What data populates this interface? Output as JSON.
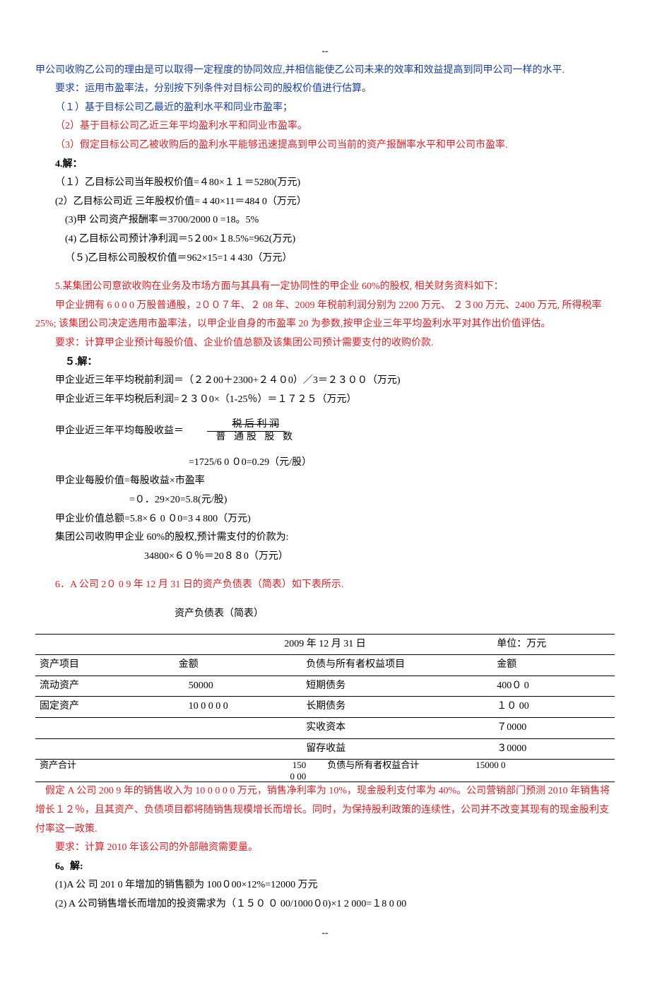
{
  "hdr": "--",
  "p1": "甲公司收购乙公司的理由是可以取得一定程度的协同效应,并相信能使乙公司未来的效率和效益提高到同甲公司一样的水平.",
  "p2": "要求：运用市盈率法，分别按下列条件对目标公司的股权价值进行估算。",
  "p3": "（１）基于目标公司乙最近的盈利水平和同业市盈率；",
  "p4": "（2）基于目标公司乙近三年平均盈利水平和同业市盈率。",
  "p5": "（3）假定目标公司乙被收购后的盈利水平能够迅速提高到甲公司当前的资产报酬率水平和甲公司市盈率.",
  "p6": "4.解：",
  "p7": "（１）乙目标公司当年股权价值=４80×１１＝5280(万元)",
  "p8": " (2）乙目标公司近 三年股权价值= 4 40×11＝484 0（万元）",
  "p9": " (3)甲 公司资产报酬率＝3700/2000 0 =18。5%",
  "p10": " (4) 乙目标公司预计净利润＝5２00×１8.5%=962(万元)",
  "p11": "（５)乙目标公司股权价值＝962×15=1 4 430（万元）",
  "p12": "5.某集团公司意欲收购在业务及市场方面与其具有一定协同性的甲企业 60%的股权, 相关财务资料如下：",
  "p13": "甲企业拥有 6 0 0 0 万股普通股，2００７年、２ 08 年、2009 年税前利润分别为 2200 万元、 ２３00 万元、2400 万元, 所得税率 25%; 该集团公司决定选用市盈率法，以甲企业自身的市盈率 20 为参数,按甲企业三年平均盈利水平对其作出价值评估。",
  "p14": "要求：计算甲企业预计每股价值、企业价值总额及该集团公司预计需要支付的收购价款.",
  "p15": "５.解：",
  "p16": "甲企业近三年平均税前利润＝（２２00＋2300+２４０0）／3＝２３００（万元)",
  "p17": "甲企业近三年平均税后利润=２３０0×（1-25％）＝１７２５（万元）",
  "p18_left": "甲企业近三年平均每股收益＝",
  "p18_top": "税 后 利 润",
  "p18_bot": "普 通股 股 数",
  "p19": "=1725/6 0 ０0=0.29（元/股）",
  "p20": "甲企业每股价值=每股收益×市盈率",
  "p21": "=０．29×20=5.8(元/股)",
  "p22": "甲企业价值总额=5.8×６ 0 ０0=3 4 800（万元)",
  "p23": "集团公司收购甲企业 60%的股权,预计需支付的价款为:",
  "p24": "34800×６０％＝20８８0（万元）",
  "p25": "6．A 公司 2０ 0 9 年 12 月 31 日的资产负债表（简表）如下表所示.",
  "tbl_title": "资产负债表（简表）",
  "tbl_date": "2009 年 12 月 31 日",
  "tbl_unit": "单位：万元",
  "th1": "资产项目",
  "th2": "金额",
  "th3": "负债与所有者权益项目",
  "th4": "金额",
  "r1c1": "流动资产",
  "r1c2": "50000",
  "r1c3": "短期债务",
  "r1c4": "400０ 0",
  "r2c1": "固定资产",
  "r2c2": "10 0 0 0 0",
  "r2c3": "长期债务",
  "r2c4": "１０ 00",
  "r3c3": "实收资本",
  "r3c4": "７0000",
  "r4c3": "留存收益",
  "r4c4": "３0000",
  "tf1": "资产合计",
  "tf2a": "150",
  "tf2b": "0 00",
  "tf3": "负债与所有者权益合计",
  "tf4": "15000 0",
  "p26": "    假定 A 公司 200 9 年的销售收入为 10 0 0 0 0 万元，销售净利率为 10%，现金股利支付率为 40%。公司营销部门预测 2010 年销售将增长１２％，且其资产、负债项目都将随销售规模增长而增长。同时，为保持股利政策的连续性，公司并不改变其现有的现金股利支付率这一政策.",
  "p27": "要求：计算 2010 年该公司的外部融资需要量。",
  "p28": "6。解:",
  "p29": " (1)A 公 司 201 0 年增加的销售额为 100０00×12%=12000 万元",
  "p30": " (2) A 公司销售增长而增加的投资需求为（１５０ ０ 00/1000０0)×1 2 000=１8 0 00",
  "chart_data": {
    "type": "table",
    "title": "资产负债表（简表）2009年12月31日 单位：万元",
    "columns": [
      "资产项目",
      "金额",
      "负债与所有者权益项目",
      "金额"
    ],
    "rows": [
      [
        "流动资产",
        50000,
        "短期债务",
        40000
      ],
      [
        "固定资产",
        100000,
        "长期债务",
        10000
      ],
      [
        "",
        "",
        "实收资本",
        70000
      ],
      [
        "",
        "",
        "留存收益",
        30000
      ],
      [
        "资产合计",
        150000,
        "负债与所有者权益合计",
        150000
      ]
    ]
  }
}
